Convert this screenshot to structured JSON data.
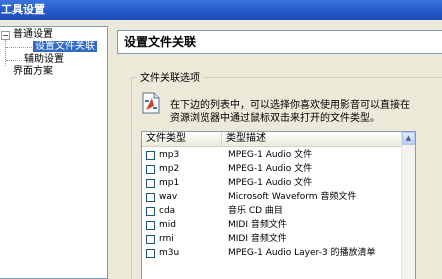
{
  "window": {
    "title": "工具设置"
  },
  "tree": {
    "items": [
      {
        "label": "普通设置",
        "expander": "−"
      },
      {
        "label": "设置文件关联"
      },
      {
        "label": "辅助设置"
      },
      {
        "label": "界面方案"
      }
    ]
  },
  "panel": {
    "header": "设置文件关联",
    "group_title": "文件关联选项",
    "info_lines": [
      "在下边的列表中，可以选择你喜欢使用影音可以直接在",
      "资源浏览器中通过鼠标双击来打开的文件类型。"
    ]
  },
  "list": {
    "columns": [
      "文件类型",
      "类型描述"
    ],
    "rows": [
      {
        "ext": "mp3",
        "desc": "MPEG-1 Audio 文件"
      },
      {
        "ext": "mp2",
        "desc": "MPEG-1 Audio 文件"
      },
      {
        "ext": "mp1",
        "desc": "MPEG-1 Audio 文件"
      },
      {
        "ext": "wav",
        "desc": "Microsoft Waveform 音频文件"
      },
      {
        "ext": "cda",
        "desc": "音乐 CD 曲目"
      },
      {
        "ext": "mid",
        "desc": "MIDI 音频文件"
      },
      {
        "ext": "rmi",
        "desc": "MIDI 音频文件"
      },
      {
        "ext": "m3u",
        "desc": "MPEG-1 Audio Layer-3 的播放清单"
      }
    ],
    "scroll_up_icon": "triangle-up"
  }
}
